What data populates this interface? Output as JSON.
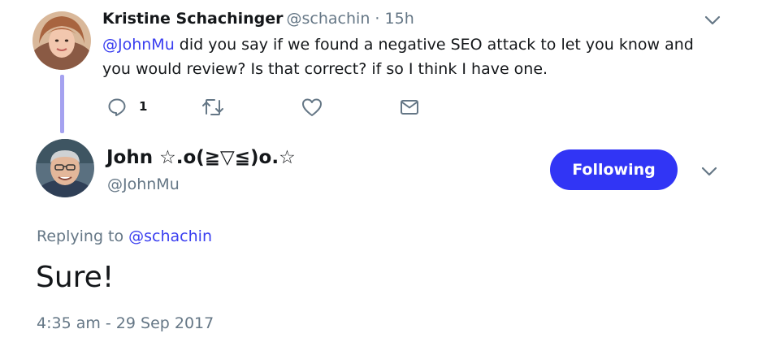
{
  "parent_tweet": {
    "author_name": "Kristine Schachinger",
    "author_handle": "@schachin",
    "separator": "·",
    "time_ago": "15h",
    "mention": "@JohnMu",
    "text": " did you say if we found a negative SEO attack to let you know and you would review? Is that correct? if so I think I have one.",
    "reply_count": "1",
    "icons": {
      "reply": "reply-icon",
      "retweet": "retweet-icon",
      "like": "heart-icon",
      "dm": "envelope-icon",
      "more": "chevron-down-icon"
    }
  },
  "main_tweet": {
    "author_name": "John ☆.o(≧▽≦)o.☆",
    "author_handle": "@JohnMu",
    "follow_button_label": "Following",
    "replying_prefix": "Replying to ",
    "replying_to": "@schachin",
    "text": "Sure!",
    "timestamp": "4:35 am - 29 Sep 2017",
    "icons": {
      "more": "chevron-down-icon"
    }
  },
  "colors": {
    "accent": "#3135f5",
    "mention": "#3a3ef0",
    "thread_line": "#a5a2f0",
    "muted_text": "#657786"
  }
}
